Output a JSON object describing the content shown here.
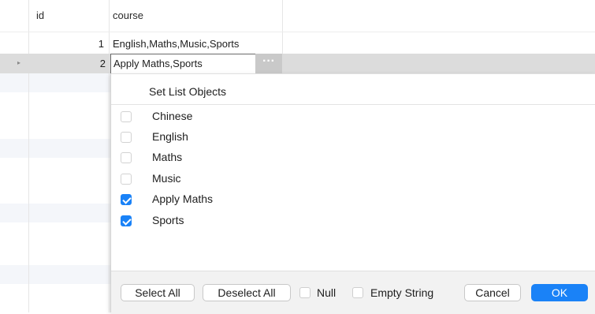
{
  "table": {
    "columns": [
      "id",
      "course"
    ],
    "rows": [
      {
        "id": "1",
        "course": "English,Maths,Music,Sports"
      },
      {
        "id": "2",
        "course": "Apply Maths,Sports"
      }
    ]
  },
  "editor": {
    "ellipsis": "···",
    "row_arrow": "▸"
  },
  "popup": {
    "title": "Set List Objects",
    "options": [
      {
        "label": "Chinese",
        "checked": false
      },
      {
        "label": "English",
        "checked": false
      },
      {
        "label": "Maths",
        "checked": false
      },
      {
        "label": "Music",
        "checked": false
      },
      {
        "label": "Apply Maths",
        "checked": true
      },
      {
        "label": "Sports",
        "checked": true
      }
    ],
    "footer": {
      "select_all": "Select All",
      "deselect_all": "Deselect All",
      "null_label": "Null",
      "empty_string_label": "Empty String",
      "cancel": "Cancel",
      "ok": "OK"
    }
  },
  "colors": {
    "accent": "#1a82f7",
    "selected_row": "#dcdcdc"
  }
}
